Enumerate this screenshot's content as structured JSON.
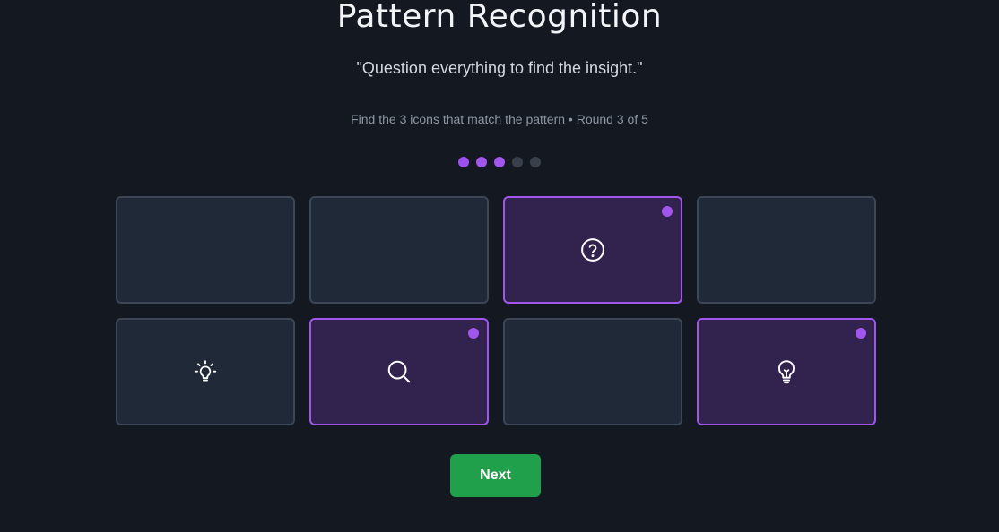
{
  "header": {
    "title": "Pattern Recognition",
    "quote": "\"Question everything to find the insight.\"",
    "instructions": "Find the 3 icons that match the pattern • Round 3 of 5"
  },
  "progress": {
    "current_round": 3,
    "total_rounds": 5
  },
  "colors": {
    "accent": "#a257ec",
    "button": "#20a04b",
    "card": "#1f2937",
    "card_selected": "#31224e"
  },
  "cards": [
    {
      "icon": "",
      "selected": false
    },
    {
      "icon": "",
      "selected": false
    },
    {
      "icon": "question-circle-icon",
      "selected": true
    },
    {
      "icon": "",
      "selected": false
    },
    {
      "icon": "lightbulb-shining-icon",
      "selected": false
    },
    {
      "icon": "search-icon",
      "selected": true
    },
    {
      "icon": "",
      "selected": false
    },
    {
      "icon": "lightbulb-icon",
      "selected": true
    }
  ],
  "actions": {
    "next_label": "Next"
  }
}
